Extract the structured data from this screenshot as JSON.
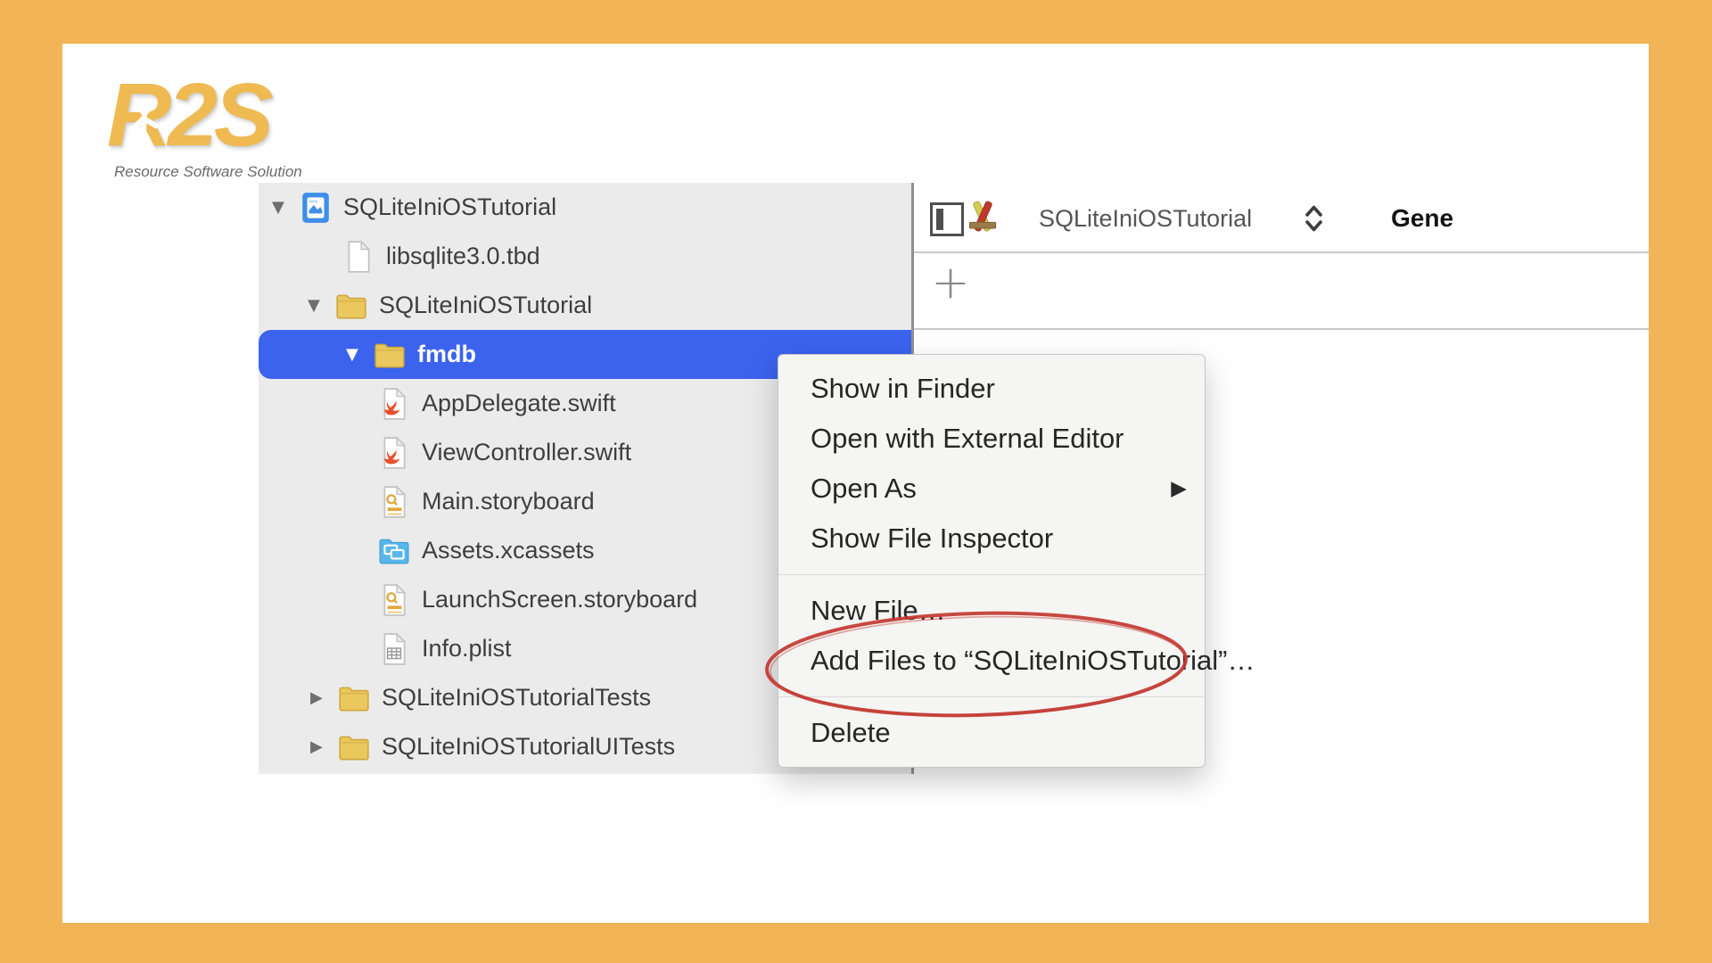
{
  "window": {
    "frame_color": "#F1B557",
    "surface_color": "#FFFFFF"
  },
  "logo": {
    "text": "R2S",
    "tagline": "Resource Software Solution",
    "color": "#EFBA52"
  },
  "navigator": {
    "background": "#EBEBEB",
    "selection_color": "#3B63EE",
    "items": [
      {
        "label": "SQLiteIniOSTutorial",
        "icon": "xcode-project",
        "disclosure": "open",
        "indent": 15,
        "selected": false
      },
      {
        "label": "libsqlite3.0.tbd",
        "icon": "document",
        "disclosure": null,
        "indent": 93,
        "selected": false
      },
      {
        "label": "SQLiteIniOSTutorial",
        "icon": "folder",
        "disclosure": "open",
        "indent": 55,
        "selected": false
      },
      {
        "label": "fmdb",
        "icon": "folder",
        "disclosure": "open",
        "indent": 98,
        "selected": true
      },
      {
        "label": "AppDelegate.swift",
        "icon": "swift-file",
        "disclosure": null,
        "indent": 133,
        "selected": false
      },
      {
        "label": "ViewController.swift",
        "icon": "swift-file",
        "disclosure": null,
        "indent": 133,
        "selected": false
      },
      {
        "label": "Main.storyboard",
        "icon": "storyboard",
        "disclosure": null,
        "indent": 133,
        "selected": false
      },
      {
        "label": "Assets.xcassets",
        "icon": "asset-catalog",
        "disclosure": null,
        "indent": 133,
        "selected": false
      },
      {
        "label": "LaunchScreen.storyboard",
        "icon": "storyboard",
        "disclosure": null,
        "indent": 133,
        "selected": false
      },
      {
        "label": "Info.plist",
        "icon": "plist",
        "disclosure": null,
        "indent": 133,
        "selected": false
      },
      {
        "label": "SQLiteIniOSTutorialTests",
        "icon": "folder",
        "disclosure": "closed",
        "indent": 58,
        "selected": false
      },
      {
        "label": "SQLiteIniOSTutorialUITests",
        "icon": "folder",
        "disclosure": "closed",
        "indent": 58,
        "selected": false
      }
    ]
  },
  "jumpbar": {
    "target_name": "SQLiteIniOSTutorial",
    "tab_label_partial": "Gene",
    "add_button_label": "+"
  },
  "context_menu": {
    "annotation_color": "#C23832",
    "groups": [
      {
        "items": [
          {
            "label": "Show in Finder"
          },
          {
            "label": "Open with External Editor"
          },
          {
            "label": "Open As",
            "submenu": true
          },
          {
            "label": "Show File Inspector"
          }
        ]
      },
      {
        "items": [
          {
            "label": "New File…"
          },
          {
            "label": "Add Files to “SQLiteIniOSTutorial”…",
            "circled": true
          }
        ]
      },
      {
        "items": [
          {
            "label": "Delete"
          }
        ]
      }
    ]
  }
}
